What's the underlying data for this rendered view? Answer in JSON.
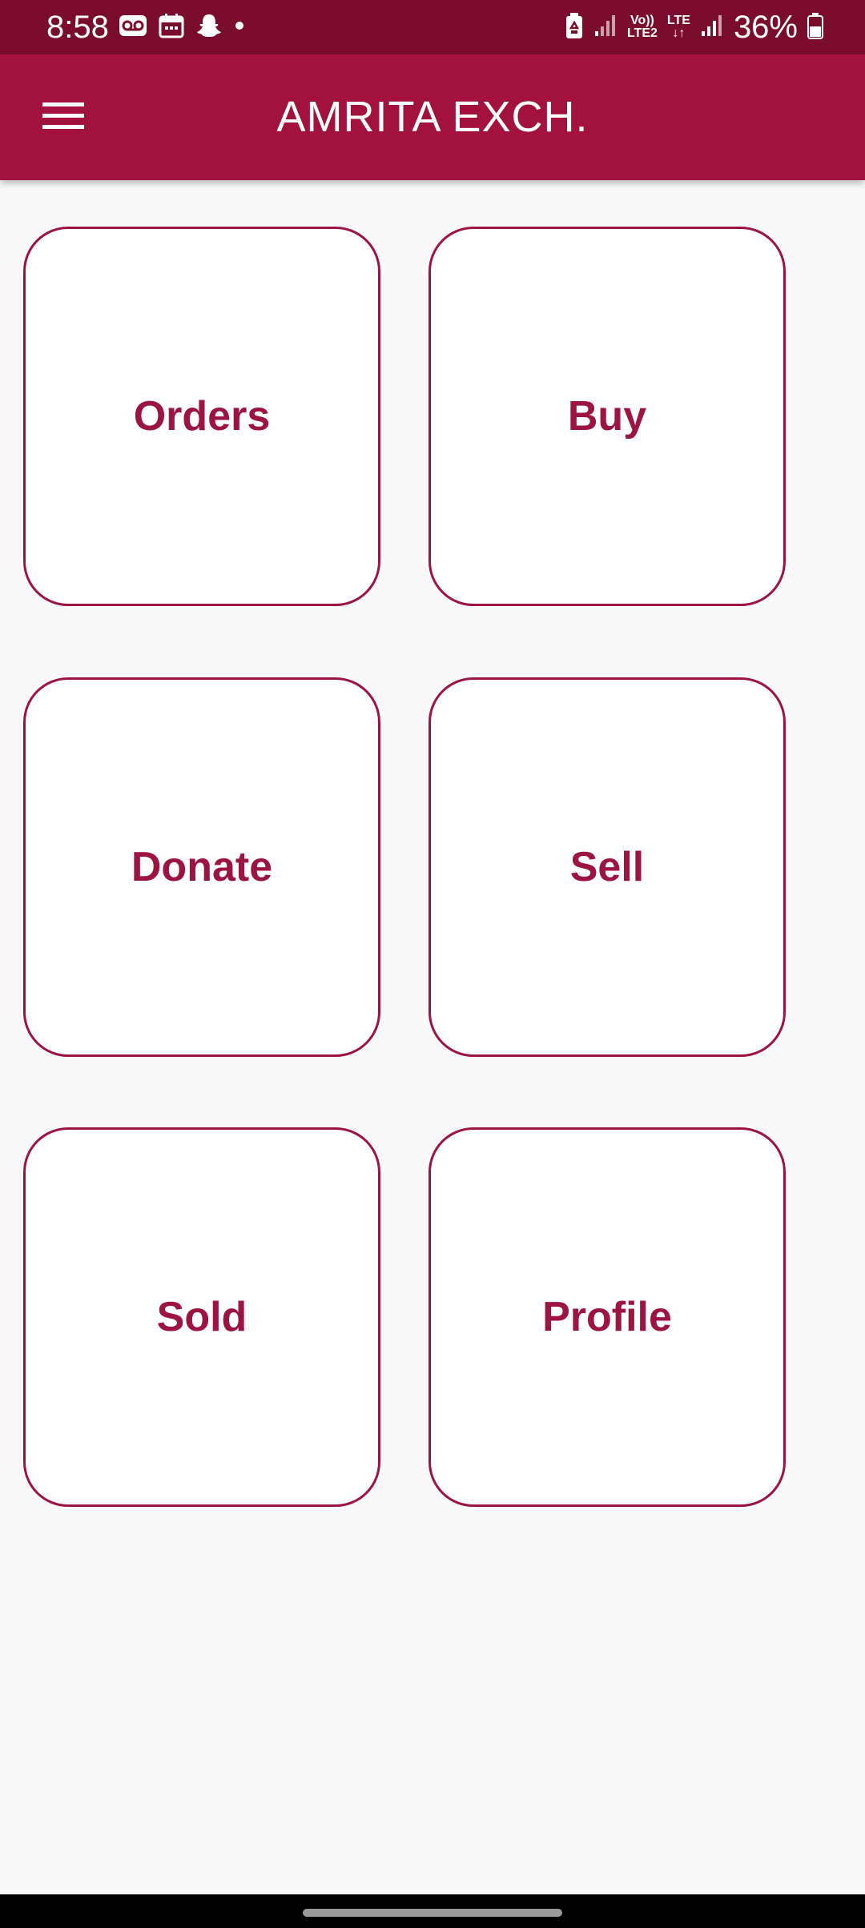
{
  "status_bar": {
    "time": "8:58",
    "left_icons": [
      "voicemail-icon",
      "calendar-icon",
      "snapchat-icon",
      "notification-dot-icon"
    ],
    "network_label_top": "Vo))",
    "network_label_bottom": "LTE2",
    "lte_label": "LTE",
    "battery_percent": "36%"
  },
  "app_bar": {
    "title": "AMRITA EXCH.",
    "menu_icon": "hamburger-menu-icon"
  },
  "tiles": [
    {
      "label": "Orders"
    },
    {
      "label": "Buy"
    },
    {
      "label": "Donate"
    },
    {
      "label": "Sell"
    },
    {
      "label": "Sold"
    },
    {
      "label": "Profile"
    }
  ],
  "colors": {
    "status_bar": "#7a0d2e",
    "app_bar": "#a3123e",
    "accent": "#9c1440",
    "background": "#f9f9f9"
  }
}
